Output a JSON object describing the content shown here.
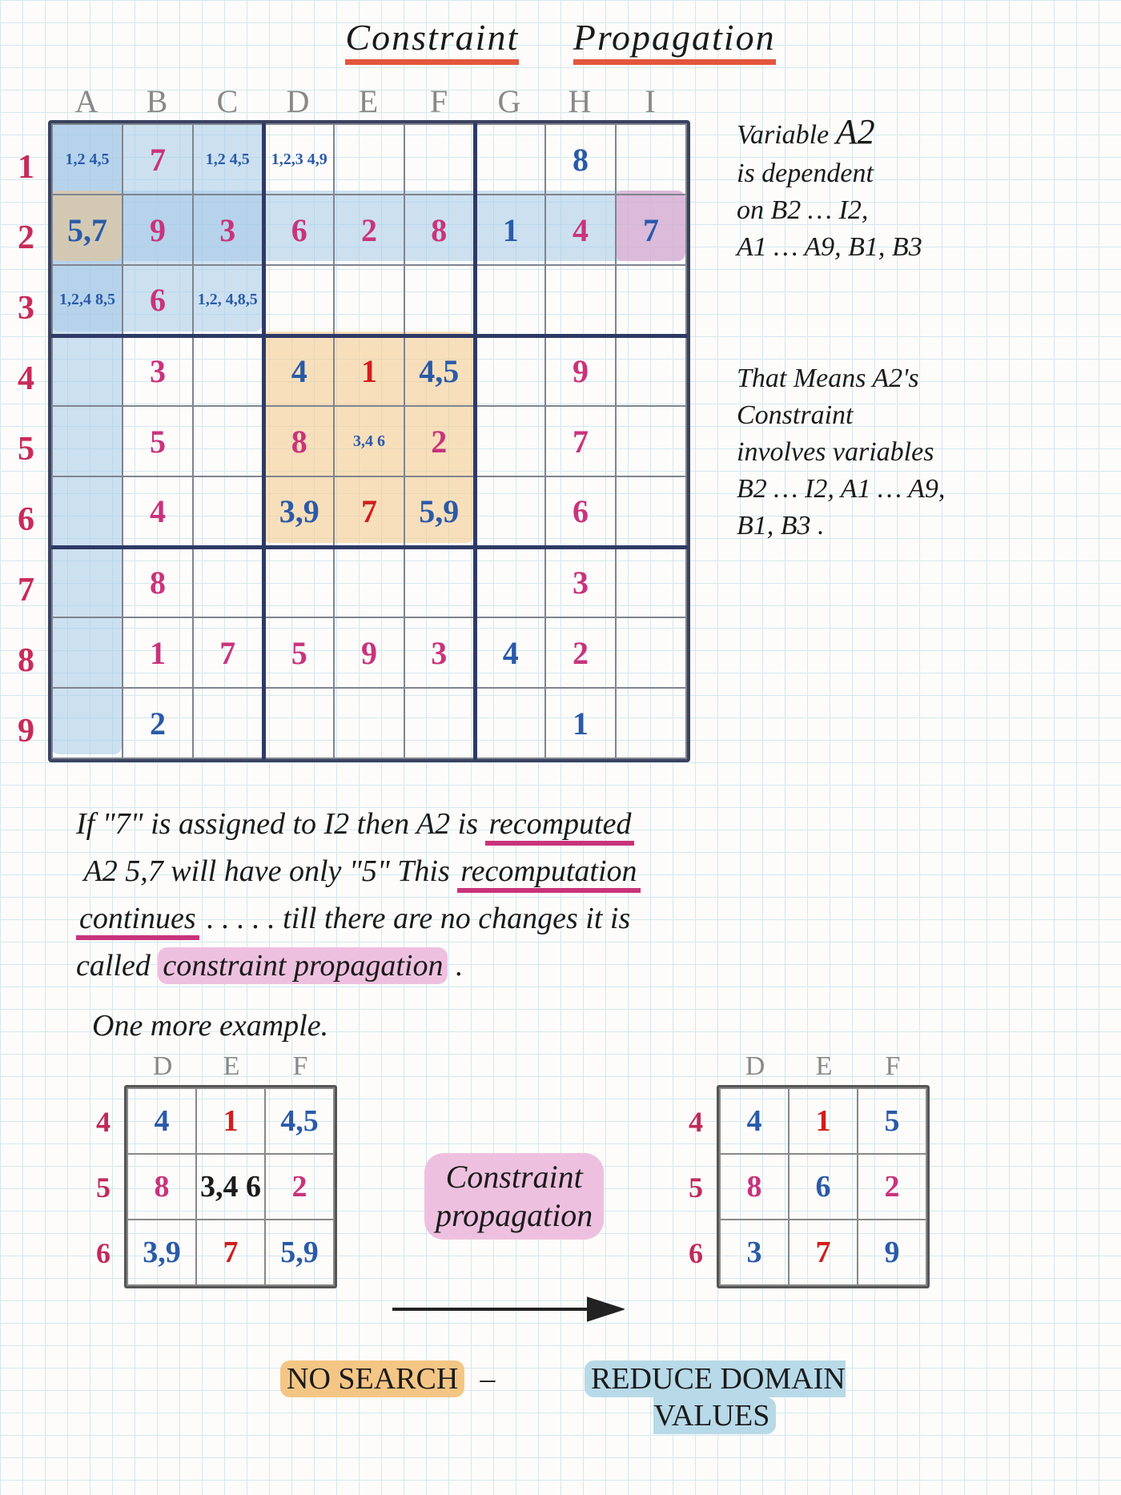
{
  "title_w1": "Constraint",
  "title_w2": "Propagation",
  "columns": [
    "A",
    "B",
    "C",
    "D",
    "E",
    "F",
    "G",
    "H",
    "I"
  ],
  "rows": [
    "1",
    "2",
    "3",
    "4",
    "5",
    "6",
    "7",
    "8",
    "9"
  ],
  "grid": [
    [
      {
        "v": "1,2\n4,5",
        "t": "sm"
      },
      {
        "v": "7",
        "c": "mag"
      },
      {
        "v": "1,2\n4,5",
        "t": "sm"
      },
      {
        "v": "1,2,3\n4,9",
        "t": "sm"
      },
      {
        "v": ""
      },
      {
        "v": ""
      },
      {
        "v": ""
      },
      {
        "v": "8",
        "c": "blue"
      },
      {
        "v": ""
      }
    ],
    [
      {
        "v": "5,7",
        "c": "blue"
      },
      {
        "v": "9",
        "c": "mag"
      },
      {
        "v": "3",
        "c": "mag"
      },
      {
        "v": "6",
        "c": "mag"
      },
      {
        "v": "2",
        "c": "mag"
      },
      {
        "v": "8",
        "c": "mag"
      },
      {
        "v": "1",
        "c": "blue"
      },
      {
        "v": "4",
        "c": "mag"
      },
      {
        "v": "7",
        "c": "blue"
      }
    ],
    [
      {
        "v": "1,2,4\n8,5",
        "t": "sm"
      },
      {
        "v": "6",
        "c": "mag"
      },
      {
        "v": "1,2,\n4,8,5",
        "t": "sm"
      },
      {
        "v": ""
      },
      {
        "v": ""
      },
      {
        "v": ""
      },
      {
        "v": ""
      },
      {
        "v": ""
      },
      {
        "v": ""
      }
    ],
    [
      {
        "v": ""
      },
      {
        "v": "3",
        "c": "mag"
      },
      {
        "v": ""
      },
      {
        "v": "4",
        "c": "blue"
      },
      {
        "v": "1",
        "c": "red"
      },
      {
        "v": "4,5",
        "c": "blue"
      },
      {
        "v": ""
      },
      {
        "v": "9",
        "c": "mag"
      },
      {
        "v": ""
      }
    ],
    [
      {
        "v": ""
      },
      {
        "v": "5",
        "c": "mag"
      },
      {
        "v": ""
      },
      {
        "v": "8",
        "c": "mag"
      },
      {
        "v": "3,4\n6",
        "t": "sm"
      },
      {
        "v": "2",
        "c": "mag"
      },
      {
        "v": ""
      },
      {
        "v": "7",
        "c": "mag"
      },
      {
        "v": ""
      }
    ],
    [
      {
        "v": ""
      },
      {
        "v": "4",
        "c": "mag"
      },
      {
        "v": ""
      },
      {
        "v": "3,9",
        "c": "blue"
      },
      {
        "v": "7",
        "c": "red"
      },
      {
        "v": "5,9",
        "c": "blue"
      },
      {
        "v": ""
      },
      {
        "v": "6",
        "c": "mag"
      },
      {
        "v": ""
      }
    ],
    [
      {
        "v": ""
      },
      {
        "v": "8",
        "c": "mag"
      },
      {
        "v": ""
      },
      {
        "v": ""
      },
      {
        "v": ""
      },
      {
        "v": ""
      },
      {
        "v": ""
      },
      {
        "v": "3",
        "c": "mag"
      },
      {
        "v": ""
      }
    ],
    [
      {
        "v": ""
      },
      {
        "v": "1",
        "c": "mag"
      },
      {
        "v": "7",
        "c": "mag"
      },
      {
        "v": "5",
        "c": "mag"
      },
      {
        "v": "9",
        "c": "mag"
      },
      {
        "v": "3",
        "c": "mag"
      },
      {
        "v": "4",
        "c": "blue"
      },
      {
        "v": "2",
        "c": "mag"
      },
      {
        "v": ""
      }
    ],
    [
      {
        "v": ""
      },
      {
        "v": "2",
        "c": "blue"
      },
      {
        "v": ""
      },
      {
        "v": ""
      },
      {
        "v": ""
      },
      {
        "v": ""
      },
      {
        "v": ""
      },
      {
        "v": "1",
        "c": "blue"
      },
      {
        "v": ""
      }
    ]
  ],
  "note1_l1": "Variable ",
  "note1_var": "A2",
  "note1_l2": "is dependent",
  "note1_l3": "on B2 … I2,",
  "note1_l4": "A1 … A9, B1, B3",
  "note2_l1": "That Means A2's",
  "note2_l2": "Constraint",
  "note2_l3": "involves variables",
  "note2_l4": "B2 … I2, A1 … A9,",
  "note2_l5": "B1, B3 .",
  "para1_a": "If \"7\" is assigned to I2 then A2 is ",
  "para1_b": "recomputed",
  "para1_c": "A2 5,7 will have only \"5\" This ",
  "para1_d": "recomputation",
  "para1_e": "continues",
  "para1_f": " . . . . . till there are no changes it is",
  "para1_g": "called   ",
  "para1_h": "constraint propagation",
  "para2": "One more example.",
  "mini_cols": [
    "D",
    "E",
    "F"
  ],
  "mini_rows": [
    "4",
    "5",
    "6"
  ],
  "mini_left": [
    [
      {
        "v": "4",
        "c": "blue"
      },
      {
        "v": "1",
        "c": "red"
      },
      {
        "v": "4,5",
        "c": "blue"
      }
    ],
    [
      {
        "v": "8",
        "c": "mag"
      },
      {
        "v": "3,4\n6",
        "t": "sm"
      },
      {
        "v": "2",
        "c": "mag"
      }
    ],
    [
      {
        "v": "3,9",
        "c": "blue"
      },
      {
        "v": "7",
        "c": "red"
      },
      {
        "v": "5,9",
        "c": "blue"
      }
    ]
  ],
  "mini_right": [
    [
      {
        "v": "4",
        "c": "blue"
      },
      {
        "v": "1",
        "c": "red"
      },
      {
        "v": "5",
        "c": "blue"
      }
    ],
    [
      {
        "v": "8",
        "c": "mag"
      },
      {
        "v": "6",
        "c": "blue"
      },
      {
        "v": "2",
        "c": "mag"
      }
    ],
    [
      {
        "v": "3",
        "c": "blue"
      },
      {
        "v": "7",
        "c": "red"
      },
      {
        "v": "9",
        "c": "blue"
      }
    ]
  ],
  "cp_label_l1": "Constraint",
  "cp_label_l2": "propagation",
  "no_search": "NO SEARCH",
  "reduce_l1": "REDUCE DOMAIN",
  "reduce_l2": "VALUES",
  "dash": "–"
}
